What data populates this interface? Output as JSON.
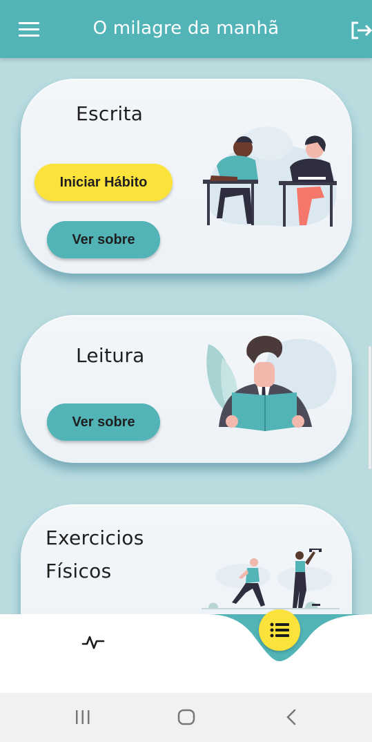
{
  "app": {
    "title": "O milagre da manhã"
  },
  "icons": {
    "menu": "menu-icon",
    "logout": "logout-icon",
    "stats": "activity-icon",
    "list": "list-icon",
    "recent": "recent-apps-icon",
    "home": "home-icon",
    "back": "back-icon"
  },
  "colors": {
    "primary": "#52b4b7",
    "accent": "#fbe33b",
    "background": "#b9dcdf",
    "card": "#eef3f8"
  },
  "habits": [
    {
      "title": "Escrita",
      "start_label": "Iniciar Hábito",
      "about_label": "Ver sobre"
    },
    {
      "title": "Leitura",
      "about_label": "Ver sobre"
    },
    {
      "title_line1": "Exercicios",
      "title_line2": "Físicos"
    }
  ]
}
